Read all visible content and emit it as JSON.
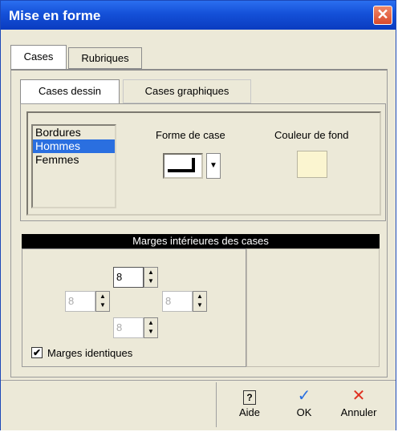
{
  "window": {
    "title": "Mise en forme",
    "close_glyph": "✕"
  },
  "tabs": {
    "cases": "Cases",
    "rubriques": "Rubriques"
  },
  "subtabs": {
    "cases_dessin": "Cases dessin",
    "cases_graphiques": "Cases graphiques"
  },
  "list": {
    "items": [
      "Bordures",
      "Hommes",
      "Femmes"
    ],
    "selected_index": 1
  },
  "forme": {
    "label": "Forme de case",
    "dropdown_glyph": "▼"
  },
  "couleur": {
    "label": "Couleur de fond",
    "swatch_color": "#fbf5d0"
  },
  "marges": {
    "header": "Marges intérieures des cases",
    "top": "8",
    "left": "8",
    "right": "8",
    "bottom": "8",
    "checkbox_label": "Marges identiques",
    "checkbox_checked": true,
    "check_glyph": "✔"
  },
  "buttons": {
    "aide": {
      "label": "Aide",
      "icon": "help-icon",
      "glyph": "?"
    },
    "ok": {
      "label": "OK",
      "icon": "check-icon",
      "glyph": "✓"
    },
    "annuler": {
      "label": "Annuler",
      "icon": "cross-icon",
      "glyph": "✕"
    }
  },
  "spinner_glyphs": {
    "up": "▲",
    "down": "▼"
  }
}
